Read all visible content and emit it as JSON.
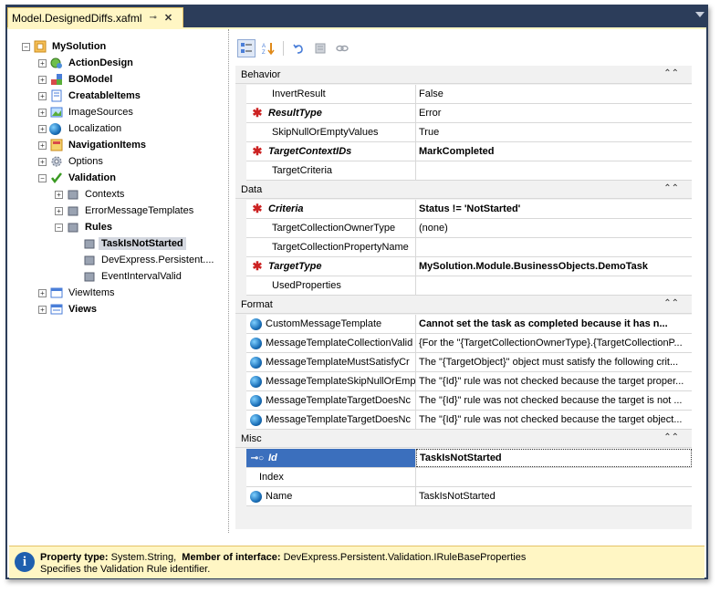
{
  "tab": {
    "title": "Model.DesignedDiffs.xafml"
  },
  "tree": {
    "items": [
      {
        "label": "MySolution"
      },
      {
        "label": "ActionDesign"
      },
      {
        "label": "BOModel"
      },
      {
        "label": "CreatableItems"
      },
      {
        "label": "ImageSources"
      },
      {
        "label": "Localization"
      },
      {
        "label": "NavigationItems"
      },
      {
        "label": "Options"
      },
      {
        "label": "Validation"
      },
      {
        "label": "Contexts"
      },
      {
        "label": "ErrorMessageTemplates"
      },
      {
        "label": "Rules"
      },
      {
        "label": "TaskIsNotStarted"
      },
      {
        "label": "DevExpress.Persistent...."
      },
      {
        "label": "EventIntervalValid"
      },
      {
        "label": "ViewItems"
      },
      {
        "label": "Views"
      }
    ]
  },
  "grid": {
    "categories": [
      {
        "label": "Behavior"
      },
      {
        "label": "Data"
      },
      {
        "label": "Format"
      },
      {
        "label": "Misc"
      }
    ],
    "rows": [
      {
        "name": "InvertResult",
        "value": "False"
      },
      {
        "name": "ResultType",
        "value": "Error"
      },
      {
        "name": "SkipNullOrEmptyValues",
        "value": "True"
      },
      {
        "name": "TargetContextIDs",
        "value": "MarkCompleted"
      },
      {
        "name": "TargetCriteria",
        "value": ""
      },
      {
        "name": "Criteria",
        "value": "Status != 'NotStarted'"
      },
      {
        "name": "TargetCollectionOwnerType",
        "value": "(none)"
      },
      {
        "name": "TargetCollectionPropertyName",
        "value": ""
      },
      {
        "name": "TargetType",
        "value": "MySolution.Module.BusinessObjects.DemoTask"
      },
      {
        "name": "UsedProperties",
        "value": ""
      },
      {
        "name": "CustomMessageTemplate",
        "value": "Cannot set the task as completed because it has n..."
      },
      {
        "name": "MessageTemplateCollectionValid",
        "value": "{For the \"{TargetCollectionOwnerType}.{TargetCollectionP..."
      },
      {
        "name": "MessageTemplateMustSatisfyCr",
        "value": "The \"{TargetObject}\" object must satisfy the following crit..."
      },
      {
        "name": "MessageTemplateSkipNullOrEmp",
        "value": "The \"{Id}\" rule was not checked because the target proper..."
      },
      {
        "name": "MessageTemplateTargetDoesNc",
        "value": "The \"{Id}\" rule was not checked because the target is not ..."
      },
      {
        "name": "MessageTemplateTargetDoesNc",
        "value": "The \"{Id}\" rule was not checked because the target object..."
      },
      {
        "name": "Id",
        "value": "TaskIsNotStarted"
      },
      {
        "name": "Index",
        "value": ""
      },
      {
        "name": "Name",
        "value": "TaskIsNotStarted"
      }
    ]
  },
  "status": {
    "property_type_label": "Property type:",
    "property_type_value": "System.String,",
    "member_label": "Member of interface:",
    "member_value": "DevExpress.Persistent.Validation.IRuleBaseProperties",
    "description": "Specifies the Validation Rule identifier."
  }
}
